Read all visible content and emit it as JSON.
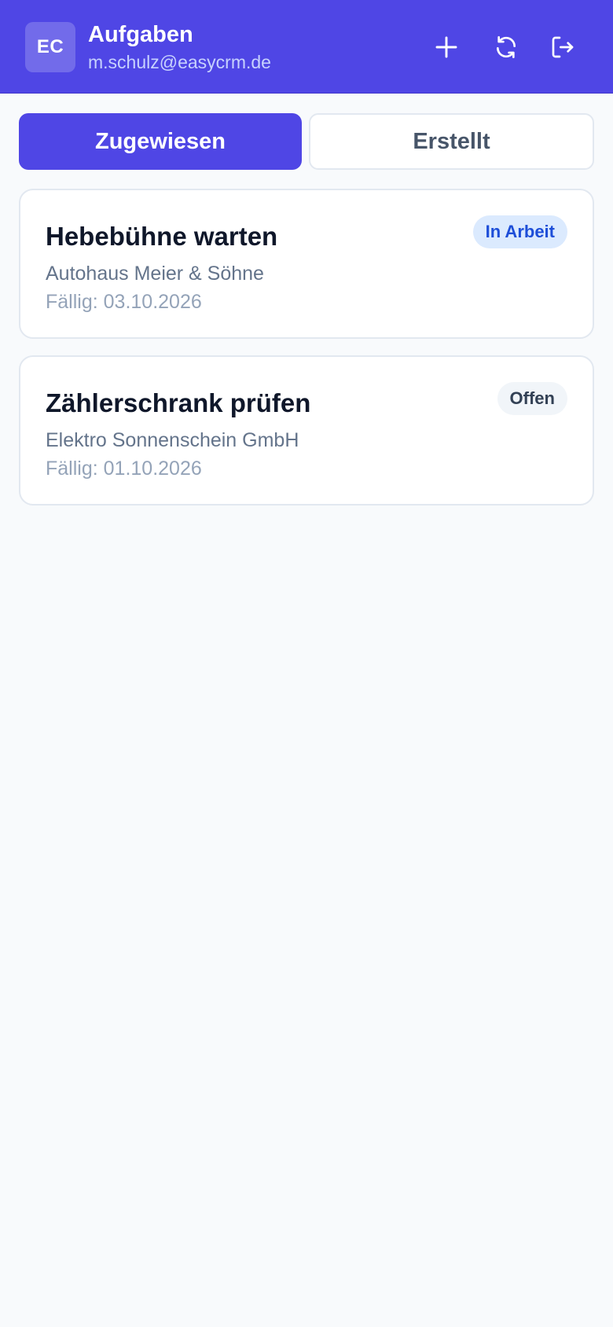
{
  "header": {
    "avatar_initials": "EC",
    "title": "Aufgaben",
    "subtitle": "m.schulz@easycrm.de",
    "actions": [
      {
        "name": "add",
        "icon": "plus-icon"
      },
      {
        "name": "refresh",
        "icon": "refresh-icon"
      },
      {
        "name": "logout",
        "icon": "logout-icon"
      }
    ]
  },
  "tabs": [
    {
      "label": "Zugewiesen",
      "active": true
    },
    {
      "label": "Erstellt",
      "active": false
    }
  ],
  "tasks": [
    {
      "title": "Hebebühne warten",
      "company": "Autohaus Meier & Söhne",
      "due": "Fällig: 03.10.2026",
      "status": "In Arbeit",
      "status_color": "#1d4ed8"
    },
    {
      "title": "Zählerschrank prüfen",
      "company": "Elektro Sonnenschein GmbH",
      "due": "Fällig: 01.10.2026",
      "status": "Offen",
      "status_color": "#334155"
    }
  ],
  "colors": {
    "accent": "#4f46e5",
    "background": "#f8fafc"
  }
}
